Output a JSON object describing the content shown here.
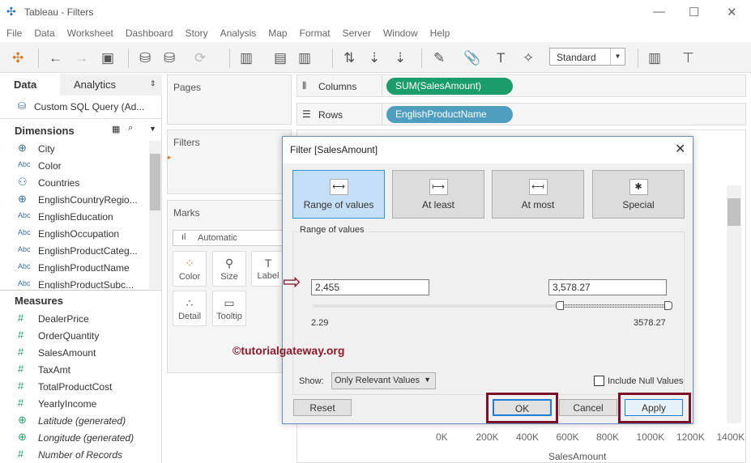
{
  "window": {
    "title": "Tableau - Filters",
    "minimize": "—",
    "maximize": "☐",
    "close": "✕"
  },
  "menu": [
    "File",
    "Data",
    "Worksheet",
    "Dashboard",
    "Story",
    "Analysis",
    "Map",
    "Format",
    "Server",
    "Window",
    "Help"
  ],
  "toolbar": {
    "fit_select": "Standard"
  },
  "left_pane": {
    "tabs": [
      "Data",
      "Analytics"
    ],
    "datasource": "Custom SQL Query (Ad...",
    "dimensions_title": "Dimensions",
    "dimensions": [
      {
        "icon": "globe",
        "label": "City"
      },
      {
        "icon": "Abc",
        "label": "Color"
      },
      {
        "icon": "hier",
        "label": "Countries"
      },
      {
        "icon": "globe",
        "label": "EnglishCountryRegio..."
      },
      {
        "icon": "Abc",
        "label": "EnglishEducation"
      },
      {
        "icon": "Abc",
        "label": "EnglishOccupation"
      },
      {
        "icon": "Abc",
        "label": "EnglishProductCateg..."
      },
      {
        "icon": "Abc",
        "label": "EnglishProductName"
      },
      {
        "icon": "Abc",
        "label": "EnglishProductSubc..."
      }
    ],
    "measures_title": "Measures",
    "measures": [
      {
        "label": "DealerPrice",
        "italic": false
      },
      {
        "label": "OrderQuantity",
        "italic": false
      },
      {
        "label": "SalesAmount",
        "italic": false
      },
      {
        "label": "TaxAmt",
        "italic": false
      },
      {
        "label": "TotalProductCost",
        "italic": false
      },
      {
        "label": "YearlyIncome",
        "italic": false
      },
      {
        "label": "Latitude (generated)",
        "italic": true
      },
      {
        "label": "Longitude (generated)",
        "italic": true
      },
      {
        "label": "Number of Records",
        "italic": true
      }
    ]
  },
  "cards": {
    "pages": "Pages",
    "filters": "Filters",
    "marks": "Marks",
    "mark_type": "Automatic",
    "mark_buttons": [
      "Color",
      "Size",
      "Label",
      "Detail",
      "Tooltip"
    ]
  },
  "shelves": {
    "columns_label": "Columns",
    "columns_pill": "SUM(SalesAmount)",
    "rows_label": "Rows",
    "rows_pill": "EnglishProductName",
    "columns_color": "#1a9c6b",
    "rows_color": "#4e9ec0"
  },
  "axis": {
    "ticks": [
      "0K",
      "200K",
      "400K",
      "600K",
      "800K",
      "1000K",
      "1200K",
      "1400K"
    ],
    "title": "SalesAmount"
  },
  "dialog": {
    "title": "Filter [SalesAmount]",
    "options": [
      "Range of values",
      "At least",
      "At most",
      "Special"
    ],
    "group_label": "Range of values",
    "min_value": "2,455",
    "max_value": "3,578.27",
    "range_min": "2.29",
    "range_max": "3578.27",
    "slider_low_fraction": 0.686,
    "slider_high_fraction": 1.0,
    "show_label": "Show:",
    "show_select": "Only Relevant Values",
    "include_null": "Include Null Values",
    "buttons": {
      "reset": "Reset",
      "ok": "OK",
      "cancel": "Cancel",
      "apply": "Apply"
    }
  },
  "watermark": "©tutorialgateway.org"
}
